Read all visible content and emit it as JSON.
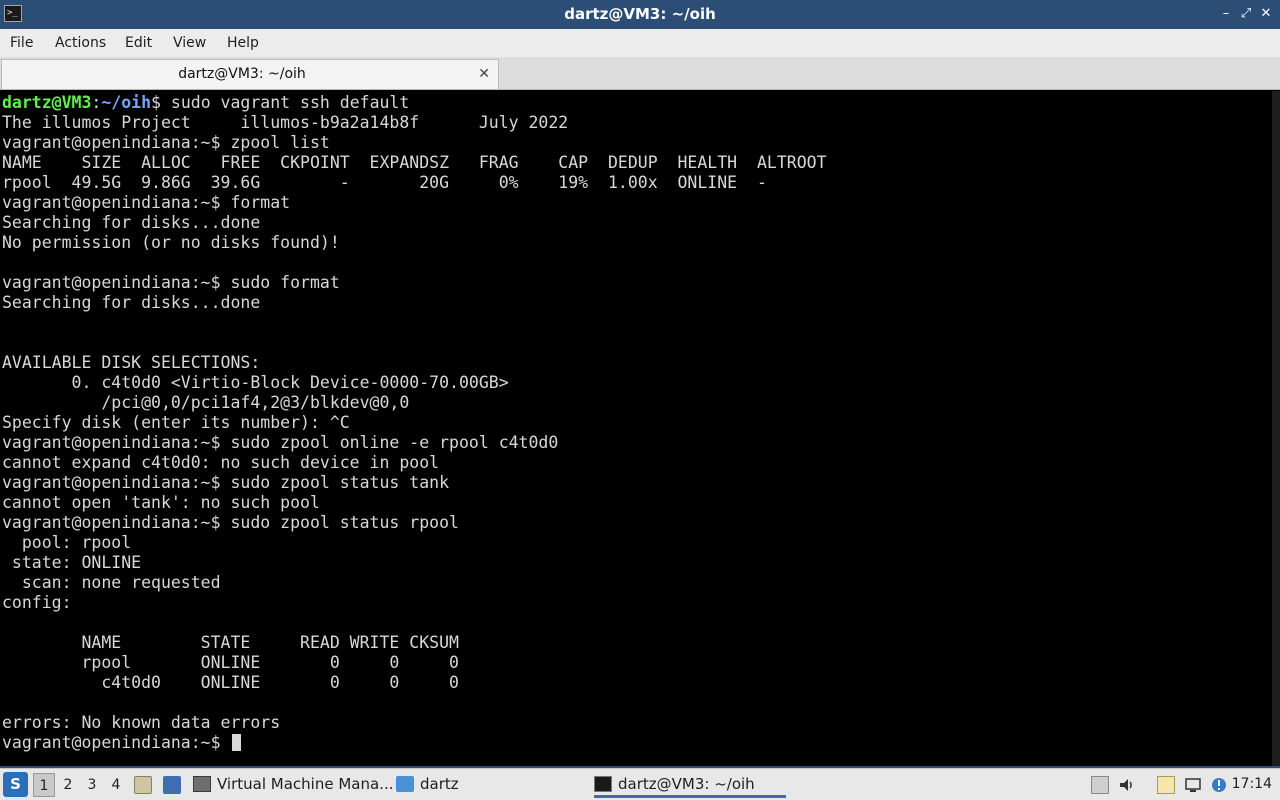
{
  "window": {
    "title": "dartz@VM3: ~/oih",
    "app_icon_glyph": ">_",
    "controls": {
      "minimize": "–",
      "maximize": "⤢",
      "close": "✕"
    },
    "titlebar_color": "#2b4d76"
  },
  "menubar": {
    "items": [
      "File",
      "Actions",
      "Edit",
      "View",
      "Help"
    ]
  },
  "tabs": [
    {
      "label": "dartz@VM3: ~/oih",
      "close_glyph": "✕"
    }
  ],
  "terminal": {
    "first_prompt": {
      "user": "dartz@VM3",
      "colon": ":",
      "path": "~/oih",
      "suffix": "$ ",
      "command": "sudo vagrant ssh default"
    },
    "lines": [
      "The illumos Project     illumos-b9a2a14b8f      July 2022",
      "vagrant@openindiana:~$ zpool list",
      "NAME    SIZE  ALLOC   FREE  CKPOINT  EXPANDSZ   FRAG    CAP  DEDUP  HEALTH  ALTROOT",
      "rpool  49.5G  9.86G  39.6G        -       20G     0%    19%  1.00x  ONLINE  -",
      "vagrant@openindiana:~$ format",
      "Searching for disks...done",
      "No permission (or no disks found)!",
      "",
      "vagrant@openindiana:~$ sudo format",
      "Searching for disks...done",
      "",
      "",
      "AVAILABLE DISK SELECTIONS:",
      "       0. c4t0d0 <Virtio-Block Device-0000-70.00GB>",
      "          /pci@0,0/pci1af4,2@3/blkdev@0,0",
      "Specify disk (enter its number): ^C",
      "vagrant@openindiana:~$ sudo zpool online -e rpool c4t0d0",
      "cannot expand c4t0d0: no such device in pool",
      "vagrant@openindiana:~$ sudo zpool status tank",
      "cannot open 'tank': no such pool",
      "vagrant@openindiana:~$ sudo zpool status rpool",
      "  pool: rpool",
      " state: ONLINE",
      "  scan: none requested",
      "config:",
      "",
      "        NAME        STATE     READ WRITE CKSUM",
      "        rpool       ONLINE       0     0     0",
      "          c4t0d0    ONLINE       0     0     0",
      "",
      "errors: No known data errors"
    ],
    "last_prompt": "vagrant@openindiana:~$ ",
    "colors": {
      "text": "#d8d8d8",
      "user": "#5ef24a",
      "path": "#7aa3ff",
      "background": "#000000"
    }
  },
  "taskbar": {
    "menu_glyph": "S",
    "workspaces": [
      {
        "label": "1",
        "active": true
      },
      {
        "label": "2",
        "active": false
      },
      {
        "label": "3",
        "active": false
      },
      {
        "label": "4",
        "active": false
      }
    ],
    "tasks": [
      {
        "label": "Virtual Machine Mana...",
        "icon": "vm-manager-icon",
        "active": false
      },
      {
        "label": "dartz",
        "icon": "folder-icon",
        "active": false
      },
      {
        "label": "dartz@VM3: ~/oih",
        "icon": "terminal-icon",
        "active": true
      }
    ],
    "clock": "17:14"
  }
}
